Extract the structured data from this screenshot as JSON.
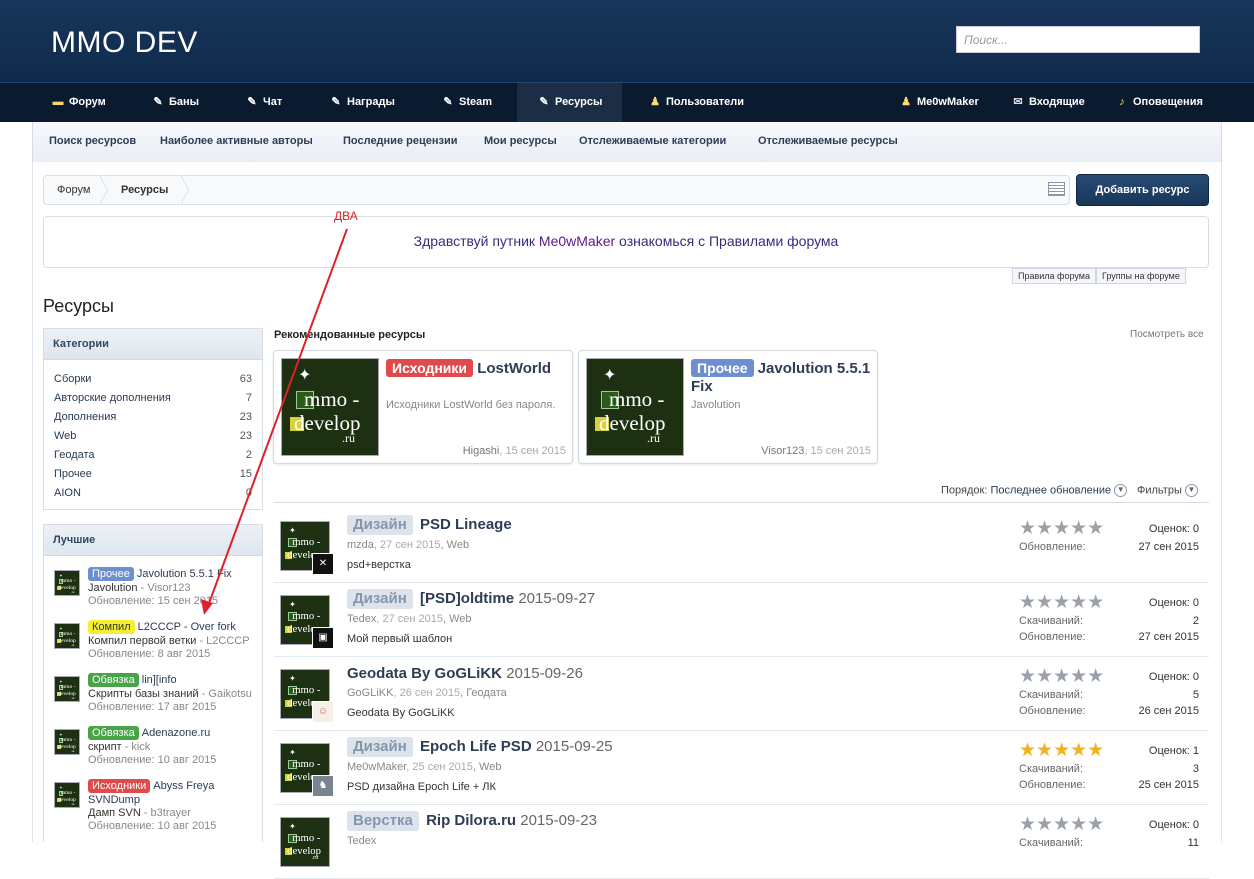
{
  "header": {
    "logo": "MMO DEV",
    "search_placeholder": "Поиск..."
  },
  "nav": {
    "items": [
      {
        "label": "Форум",
        "icon": "forum-icon"
      },
      {
        "label": "Баны",
        "icon": "pencil-icon"
      },
      {
        "label": "Чат",
        "icon": "pencil-icon"
      },
      {
        "label": "Награды",
        "icon": "pencil-icon"
      },
      {
        "label": "Steam",
        "icon": "pencil-icon"
      },
      {
        "label": "Ресурсы",
        "icon": "pencil-icon",
        "selected": true
      },
      {
        "label": "Пользователи",
        "icon": "users-icon"
      }
    ],
    "user": "Me0wMaker",
    "inbox": "Входящие",
    "alerts": "Оповещения"
  },
  "subnav": [
    "Поиск ресурсов",
    "Наиболее активные авторы",
    "Последние рецензии",
    "Мои ресурсы",
    "Отслеживаемые категории",
    "Отслеживаемые ресурсы"
  ],
  "breadcrumb": [
    "Форум",
    "Ресурсы"
  ],
  "add_button": "Добавить ресурс",
  "notice": {
    "p1": "Здравствуй путник ",
    "user": "Me0wMaker",
    "p2": " ознакомься с Правилами форума",
    "tabs": [
      "Правила форума",
      "Группы на форуме"
    ]
  },
  "annotation": "ДВА",
  "page_title": "Ресурсы",
  "categories": {
    "title": "Категории",
    "items": [
      {
        "name": "Сборки",
        "count": "63"
      },
      {
        "name": "Авторские дополнения",
        "count": "7"
      },
      {
        "name": "Дополнения",
        "count": "23"
      },
      {
        "name": "Web",
        "count": "23"
      },
      {
        "name": "Геодата",
        "count": "2"
      },
      {
        "name": "Прочее",
        "count": "15"
      },
      {
        "name": "AION",
        "count": "0"
      }
    ]
  },
  "best": {
    "title": "Лучшие",
    "items": [
      {
        "tag": "Прочее",
        "tag_color": "blue",
        "name": "Javolution 5.5.1 Fix",
        "desc": "Javolution",
        "author": "Visor123",
        "updated": "Обновление: 15 сен 2015"
      },
      {
        "tag": "Компил",
        "tag_color": "yellow",
        "name": "L2CCCP - Over fork",
        "desc": "Компил первой ветки",
        "author": "L2CCCP",
        "updated": "Обновление: 8 авг 2015"
      },
      {
        "tag": "Обвязка",
        "tag_color": "green",
        "name": "lin][info",
        "desc": "Скрипты базы знаний",
        "author": "Gaikotsu",
        "updated": "Обновление: 17 авг 2015"
      },
      {
        "tag": "Обвязка",
        "tag_color": "green",
        "name": "Adenazone.ru",
        "desc": "скрипт",
        "author": "kick",
        "updated": "Обновление: 10 авг 2015"
      },
      {
        "tag": "Исходники",
        "tag_color": "red",
        "name": "Abyss Freya SVNDump",
        "desc": "Дамп SVN",
        "author": "b3trayer",
        "updated": "Обновление: 10 авг 2015"
      }
    ]
  },
  "thumb": {
    "line1": "mmo -",
    "line2": "develop",
    "line3": ".ru"
  },
  "recommended": {
    "title": "Рекомендованные ресурсы",
    "view_all": "Посмотреть все",
    "items": [
      {
        "tag": "Исходники",
        "tag_color": "#e14a4a",
        "name": "LostWorld",
        "desc": "Исходники LostWorld без пароля.",
        "author": "Higashi",
        "date": "15 сен 2015"
      },
      {
        "tag": "Прочее",
        "tag_color": "#6e8fcf",
        "name": "Javolution 5.5.1 Fix",
        "desc": "Javolution",
        "author": "Visor123",
        "date": "15 сен 2015"
      }
    ]
  },
  "sort": {
    "label": "Порядок:",
    "value": "Последнее обновление",
    "filters": "Фильтры"
  },
  "resources": [
    {
      "tag": "Дизайн",
      "name": "PSD Lineage",
      "version": "",
      "author": "mzda",
      "date": "27 сен 2015",
      "category": "Web",
      "desc": "psd+верстка",
      "stars": 0,
      "votes": "Оценок: 0",
      "downloads": "",
      "updated_label": "Обновление:",
      "updated": "27 сен 2015",
      "avatar": "x"
    },
    {
      "tag": "Дизайн",
      "name": "[PSD]oldtime",
      "version": "2015-09-27",
      "author": "Tedex",
      "date": "27 сен 2015",
      "category": "Web",
      "desc": "Мой первый шаблон",
      "stars": 0,
      "votes": "Оценок: 0",
      "downloads": "2",
      "updated_label": "Обновление:",
      "updated": "27 сен 2015",
      "avatar": "t"
    },
    {
      "tag": "",
      "name": "Geodata By GoGLiKK",
      "version": "2015-09-26",
      "author": "GoGLiKK",
      "date": "26 сен 2015",
      "category": "Геодата",
      "desc": "Geodata By GoGLiKK",
      "stars": 0,
      "votes": "Оценок: 0",
      "downloads": "5",
      "updated_label": "Обновление:",
      "updated": "26 сен 2015",
      "avatar": "g"
    },
    {
      "tag": "Дизайн",
      "name": "Epoch Life PSD",
      "version": "2015-09-25",
      "author": "Me0wMaker",
      "date": "25 сен 2015",
      "category": "Web",
      "desc": "PSD дизайна Epoch Life + ЛК",
      "stars": 5,
      "votes": "Оценок: 1",
      "downloads": "3",
      "updated_label": "Обновление:",
      "updated": "25 сен 2015",
      "avatar": "m"
    },
    {
      "tag": "Верстка",
      "name": "Rip Dilora.ru",
      "version": "2015-09-23",
      "author": "Tedex",
      "date": "",
      "category": "",
      "desc": "",
      "stars": 0,
      "votes": "Оценок: 0",
      "downloads": "11",
      "updated_label": "",
      "updated": "",
      "avatar": ""
    }
  ],
  "labels": {
    "downloads": "Скачиваний:"
  }
}
